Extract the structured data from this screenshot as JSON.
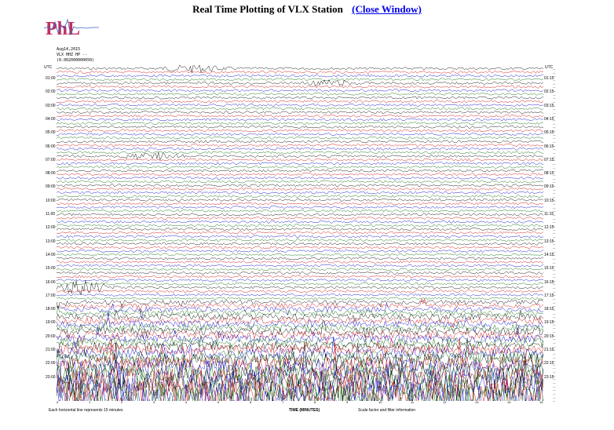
{
  "header": {
    "title": "Real Time Plotting of VLX Station",
    "close_label": "(Close Window)"
  },
  "logo": {
    "text": "PhL"
  },
  "meta": {
    "date": "Aug14,2015",
    "channel": "VLX HHZ HP --",
    "sub": "(0.002000000050)"
  },
  "axis": {
    "utc_label": "UTC",
    "hours_left": [
      "01:00",
      "02:00",
      "03:00",
      "04:00",
      "05:00",
      "06:00",
      "07:00",
      "08:00",
      "09:00",
      "10:00",
      "11:00",
      "12:00",
      "13:00",
      "14:00",
      "15:00",
      "16:00",
      "17:00",
      "18:00",
      "19:00",
      "20:00",
      "21:00",
      "22:00",
      "23:00"
    ],
    "hours_right": [
      "01:15",
      "02:15",
      "03:15",
      "04:15",
      "05:15",
      "06:15",
      "07:15",
      "08:15",
      "09:15",
      "10:15",
      "11:15",
      "12:15",
      "13:15",
      "14:15",
      "15:15",
      "16:15",
      "17:15",
      "18:15",
      "19:15",
      "20:15",
      "21:15",
      "22:15",
      "23:15"
    ],
    "minute_ticks": [
      "0",
      "1",
      "2",
      "3",
      "4",
      "5",
      "6",
      "7",
      "8",
      "9",
      "10",
      "11",
      "12",
      "13",
      "14",
      "15"
    ]
  },
  "footer": {
    "left": "Each horizontal line represents 15 minutes",
    "center": "TIME (MINUTES)",
    "right": "Scale factor and filter information"
  },
  "colors": {
    "trace_colors": [
      "#000000",
      "#cc0000",
      "#0000cc",
      "#006600"
    ],
    "link": "#0000ee"
  },
  "chart_data": {
    "type": "line",
    "title": "Real Time Plotting of VLX Station",
    "xlabel": "TIME (MINUTES)",
    "ylabel": "UTC",
    "xlim": [
      0,
      15
    ],
    "trace_count": 92,
    "trace_minutes_each": 15,
    "events": [
      {
        "hour": "01:00",
        "minute": 4.2,
        "color": "#006600",
        "strength": 0.8
      },
      {
        "hour": "02:00",
        "minute": 8.5,
        "color": "#000000",
        "strength": 0.6
      },
      {
        "hour": "07:00",
        "minute": 3.0,
        "color": "#0000cc",
        "strength": 0.7
      },
      {
        "hour": "16:00",
        "minute": 0.8,
        "color": "#cc0000",
        "strength": 1.6
      }
    ],
    "noise_increase_from_hour": "17:00",
    "heavy_noise_from_hour": "20:00"
  }
}
